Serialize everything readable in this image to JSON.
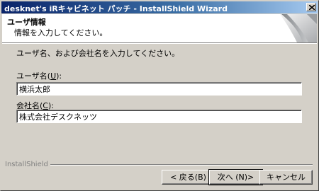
{
  "window": {
    "title": "desknet's iRキャビネット パッチ - InstallShield Wizard"
  },
  "header": {
    "title": "ユーザ情報",
    "subtitle": "情報を入力してください。"
  },
  "instruction": "ユーザ名、および会社名を入力してください。",
  "fields": {
    "user_label": "ユーザ名(",
    "user_mnemonic": "U",
    "user_label_end": "):",
    "user_value": "横浜太郎",
    "company_label": "会社名(",
    "company_mnemonic": "C",
    "company_label_end": "):",
    "company_value": "株式会社デスクネッツ"
  },
  "brand": "InstallShield",
  "buttons": {
    "back": "< 戻る(B)",
    "next": "次へ (N)>",
    "cancel": "キャンセル"
  },
  "icons": {
    "close": "close-icon",
    "header_art": "page-curl-icon"
  }
}
